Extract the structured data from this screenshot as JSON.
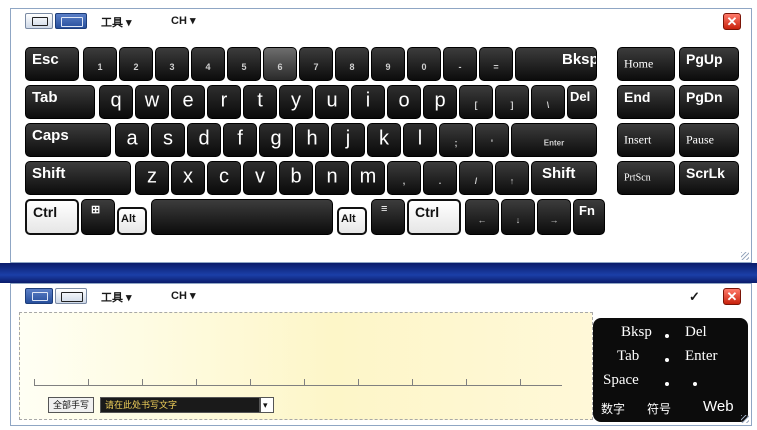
{
  "toolbar": {
    "tools_label": "工具 ▾",
    "lang_label": "CH ▾",
    "close_label": "✕"
  },
  "keyboard": {
    "row1": [
      "Esc",
      "1",
      "2",
      "3",
      "4",
      "5",
      "6",
      "7",
      "8",
      "9",
      "0",
      "-",
      "=",
      "Bksp"
    ],
    "row2": [
      "Tab",
      "q",
      "w",
      "e",
      "r",
      "t",
      "y",
      "u",
      "i",
      "o",
      "p",
      "[",
      "]",
      "\\",
      "Del"
    ],
    "row3": [
      "Caps",
      "a",
      "s",
      "d",
      "f",
      "g",
      "h",
      "j",
      "k",
      "l",
      ";",
      "'",
      "Enter"
    ],
    "row4": [
      "Shift",
      "z",
      "x",
      "c",
      "v",
      "b",
      "n",
      "m",
      ",",
      ".",
      "/",
      "↑",
      "Shift"
    ],
    "row5": [
      "Ctrl",
      "⊞",
      "Alt",
      "",
      "Alt",
      "≡",
      "Ctrl",
      "←",
      "↓",
      "→",
      "Fn"
    ],
    "nav": [
      "Home",
      "PgUp",
      "End",
      "PgDn",
      "Insert",
      "Pause",
      "PrtScn",
      "ScrLk"
    ]
  },
  "pen_panel": {
    "toolbar": {
      "tools_label": "工具 ▾",
      "lang_label": "CH ▾",
      "pen_label": "✓",
      "close_label": "✕"
    },
    "mode_all": "全部手写",
    "mode_hint": "请在此处书写文字",
    "mode_drop": "▾",
    "commands": {
      "bksp": "Bksp",
      "del": "Del",
      "tab": "Tab",
      "enter": "Enter",
      "space": "Space",
      "num": "数字",
      "sym": "符号",
      "web": "Web"
    }
  }
}
